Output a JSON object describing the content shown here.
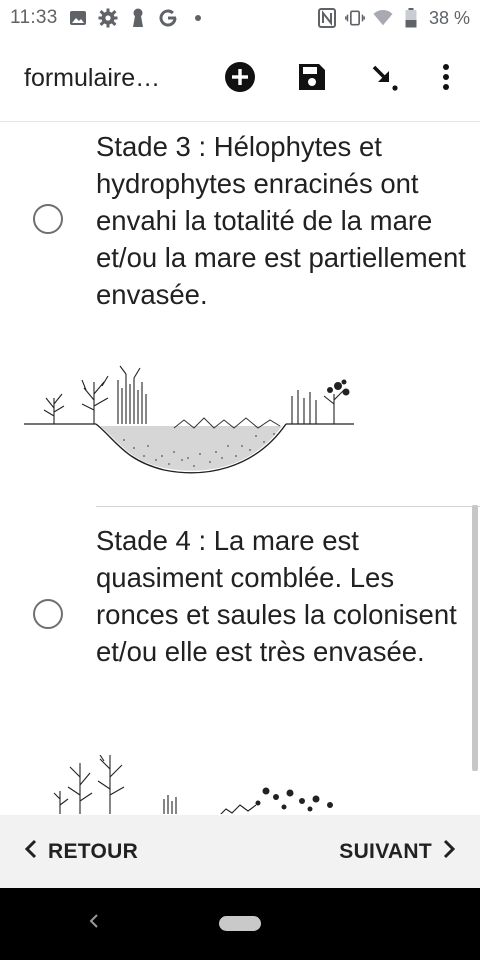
{
  "status_bar": {
    "time": "11:33",
    "battery": "38 %",
    "left_icons": [
      "image-icon",
      "settings-icon",
      "keyhole-icon",
      "google-icon",
      "dot-icon"
    ],
    "right_icons": [
      "nfc-icon",
      "vibrate-icon",
      "wifi-icon",
      "battery-icon"
    ]
  },
  "app_bar": {
    "title": "formulaire…",
    "actions": [
      "add-circle-icon",
      "save-icon",
      "download-arrow-icon",
      "more-vert-icon"
    ]
  },
  "options": [
    {
      "label": "Stade 3 : Hélophytes et hydrophytes enracinés ont envahi la totalité de la mare et/ou la mare est partiellement envasée.",
      "selected": false
    },
    {
      "label": "Stade 4 : La mare est quasiment comblée. Les ronces et saules la colonisent et/ou elle est très envasée.",
      "selected": false
    }
  ],
  "bottom_nav": {
    "back_label": "RETOUR",
    "next_label": "SUIVANT"
  },
  "colors": {
    "text": "#212121",
    "status_text": "#5f6368",
    "bottom_nav_bg": "#f2f2f2",
    "system_nav_bg": "#000000"
  }
}
